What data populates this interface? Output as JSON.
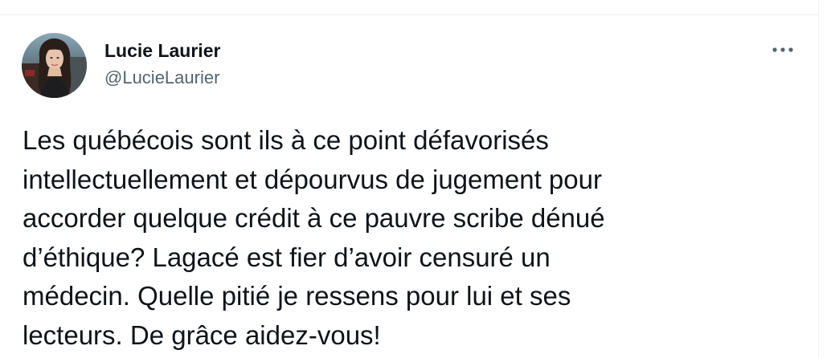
{
  "tweet": {
    "author": {
      "display_name": "Lucie Laurier",
      "handle": "@LucieLaurier"
    },
    "text": "Les québécois sont ils à ce point défavorisés\nintellectuellement et dépourvus de jugement pour\naccorder quelque crédit à ce pauvre scribe dénué\nd’éthique? Lagacé est fier d’avoir censuré un\nmédecin. Quelle pitié je ressens pour lui et ses\nlecteurs. De grâce aidez-vous!",
    "more_icon": "more-horizontal-icon"
  },
  "colors": {
    "text_primary": "#0f1419",
    "text_secondary": "#536471",
    "divider": "#eff3f4",
    "background": "#ffffff"
  }
}
